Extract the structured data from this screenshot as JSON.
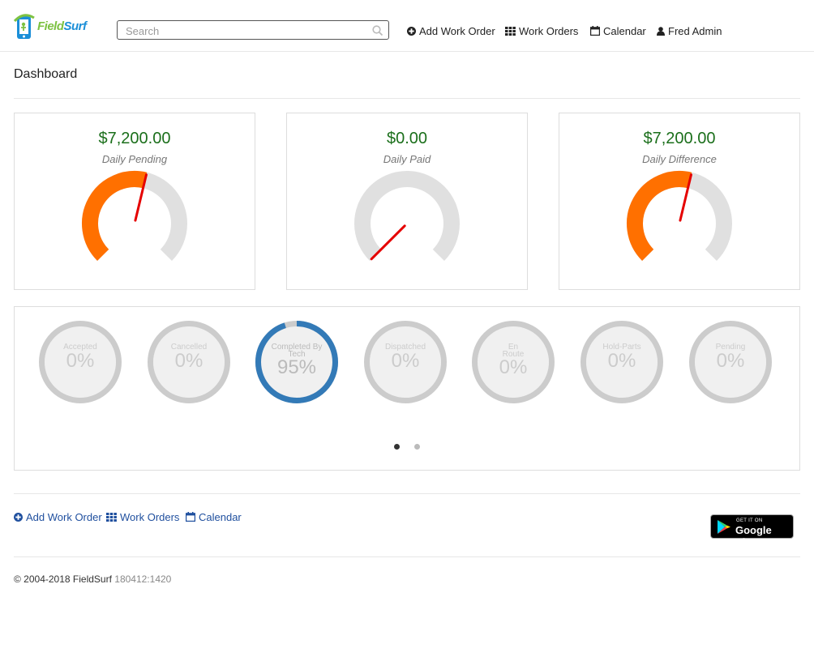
{
  "brand": {
    "name_part1": "Field",
    "name_part2": "Surf",
    "color_green": "#7dc242",
    "color_blue": "#1b8fd8"
  },
  "search": {
    "placeholder": "Search",
    "value": ""
  },
  "nav": {
    "add_work_order": "Add Work Order",
    "work_orders": "Work Orders",
    "calendar": "Calendar",
    "user": "Fred Admin"
  },
  "page": {
    "title": "Dashboard"
  },
  "stats": [
    {
      "value": "$7,200.00",
      "label": "Daily Pending",
      "fill_fraction": 0.55,
      "needle_fraction": 0.55
    },
    {
      "value": "$0.00",
      "label": "Daily Paid",
      "fill_fraction": 0,
      "needle_fraction": 0
    },
    {
      "value": "$7,200.00",
      "label": "Daily Difference",
      "fill_fraction": 0.55,
      "needle_fraction": 0.55
    }
  ],
  "statuses": [
    {
      "label": "Accepted",
      "value": "0%",
      "percent": 0
    },
    {
      "label": "Cancelled",
      "value": "0%",
      "percent": 0
    },
    {
      "label": "Completed By Tech",
      "value": "95%",
      "percent": 95
    },
    {
      "label": "Dispatched",
      "value": "0%",
      "percent": 0
    },
    {
      "label": "En Route",
      "value": "0%",
      "percent": 0
    },
    {
      "label": "Hold-Parts",
      "value": "0%",
      "percent": 0
    },
    {
      "label": "Pending",
      "value": "0%",
      "percent": 0
    }
  ],
  "carousel": {
    "pages": 2,
    "active": 0
  },
  "footer": {
    "add_work_order": "Add Work Order",
    "work_orders": "Work Orders",
    "calendar": "Calendar",
    "google_play_small": "GET IT ON",
    "google_play_big": "Google Play",
    "copyright": "© 2004-2018 FieldSurf",
    "version": "180412:1420"
  },
  "colors": {
    "money_green": "#1b6f1b",
    "gauge_orange": "#ff7000",
    "gauge_track": "#e0e0e0",
    "needle_red": "#e50000",
    "donut_blue": "#337ab7",
    "donut_track": "#cccccc",
    "link_blue": "#1f4f9e"
  }
}
